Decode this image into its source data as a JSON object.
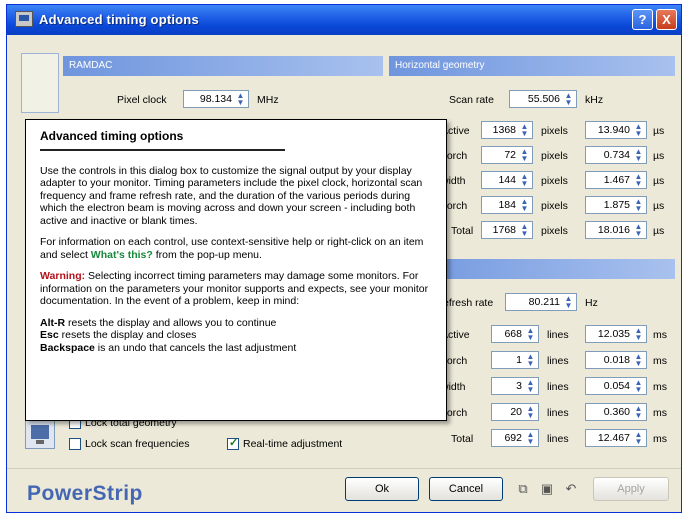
{
  "window": {
    "title": "Advanced timing options",
    "help_label": "?",
    "close_label": "X"
  },
  "ramdac": {
    "header": "RAMDAC",
    "pixel_clock_label": "Pixel clock",
    "pixel_clock_value": "98.134",
    "pixel_clock_unit": "MHz"
  },
  "horizontal": {
    "header": "Horizontal geometry",
    "scan_rate_label": "Scan rate",
    "scan_rate_value": "55.506",
    "scan_rate_unit": "kHz",
    "rows": [
      {
        "label": "Active",
        "value": "1368",
        "unit": "pixels",
        "time": "13.940",
        "time_unit": "µs"
      },
      {
        "label": "porch",
        "value": "72",
        "unit": "pixels",
        "time": "0.734",
        "time_unit": "µs"
      },
      {
        "label": "width",
        "value": "144",
        "unit": "pixels",
        "time": "1.467",
        "time_unit": "µs"
      },
      {
        "label": "porch",
        "value": "184",
        "unit": "pixels",
        "time": "1.875",
        "time_unit": "µs"
      },
      {
        "label": "Total",
        "value": "1768",
        "unit": "pixels",
        "time": "18.016",
        "time_unit": "µs"
      }
    ]
  },
  "vertical": {
    "header": "eometry",
    "refresh_label": "efresh rate",
    "refresh_value": "80.211",
    "refresh_unit": "Hz",
    "rows": [
      {
        "label": "Active",
        "value": "668",
        "unit": "lines",
        "time": "12.035",
        "time_unit": "ms"
      },
      {
        "label": "porch",
        "value": "1",
        "unit": "lines",
        "time": "0.018",
        "time_unit": "ms"
      },
      {
        "label": "width",
        "value": "3",
        "unit": "lines",
        "time": "0.054",
        "time_unit": "ms"
      },
      {
        "label": "porch",
        "value": "20",
        "unit": "lines",
        "time": "0.360",
        "time_unit": "ms"
      },
      {
        "label": "Total",
        "value": "692",
        "unit": "lines",
        "time": "12.467",
        "time_unit": "ms"
      }
    ]
  },
  "help_popup": {
    "title": "Advanced timing options",
    "para1": "Use the controls in this dialog box to customize the signal output by your display adapter to your monitor. Timing parameters include the pixel clock, horizontal scan frequency and frame refresh rate, and the duration of the various periods during which the electron beam is moving across and down your screen - including both active and inactive or blank times.",
    "para2_pre": "For information on each control, use context-sensitive help or right-click on an item and select ",
    "para2_link": "What's this?",
    "para2_post": " from the pop-up menu.",
    "warning_label": "Warning:",
    "warning_text": " Selecting incorrect timing parameters may damage some monitors. For information on the parameters your monitor supports and expects, see your monitor documentation. In the event of a problem, keep in mind:",
    "key1": "Alt-R",
    "key1_text": " resets the display and allows you to continue",
    "key2": "Esc",
    "key2_text": " resets the display and closes",
    "key3": "Backspace",
    "key3_text": " is an undo that cancels the last adjustment"
  },
  "options": {
    "lock_geometry_label": "Lock total geometry",
    "lock_scan_label": "Lock scan frequencies",
    "realtime_label": "Real-time adjustment",
    "realtime_checked": true
  },
  "footer": {
    "brand": "PowerStrip",
    "ok_label": "Ok",
    "cancel_label": "Cancel",
    "apply_label": "Apply",
    "brand_color": "#4467b3"
  }
}
